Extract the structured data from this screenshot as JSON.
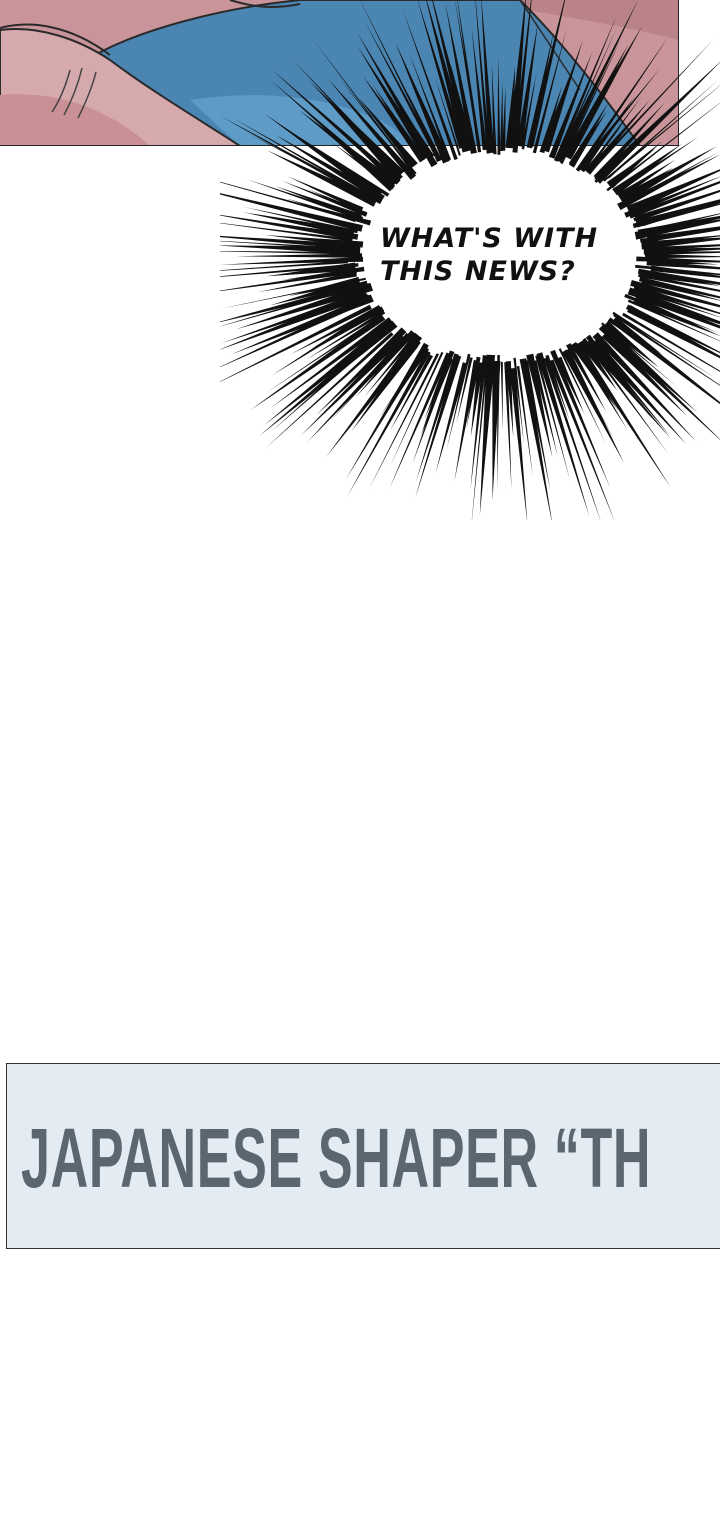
{
  "speech_bubble": {
    "line1": "WHAT'S WITH",
    "line2": "THIS NEWS?"
  },
  "banner": {
    "text": "JAPANESE SHAPER “TH"
  },
  "colors": {
    "skin": "#c48f96",
    "skin_light": "#d9aeb2",
    "phone_blue": "#4b86b3",
    "banner_bg": "#e3ebf3",
    "banner_text": "#5b6670",
    "ink": "#111111"
  }
}
